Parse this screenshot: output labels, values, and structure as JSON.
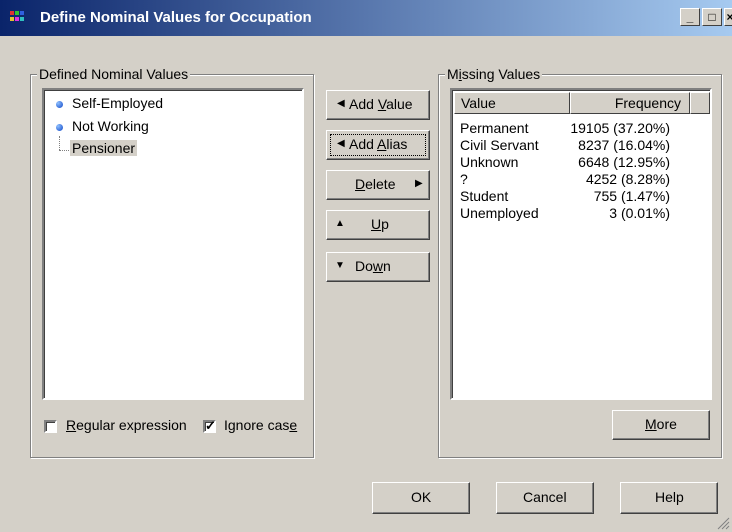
{
  "window": {
    "title": "Define Nominal Values for Occupation"
  },
  "defined": {
    "group_label": "Defined Nominal Values",
    "items": [
      {
        "label": "Self-Employed",
        "bullet": true
      },
      {
        "label": "Not Working",
        "bullet": true
      },
      {
        "label": "Pensioner",
        "bullet": false,
        "selected": true
      }
    ],
    "regex_label": "Regular expression",
    "regex_checked": false,
    "ignore_case_label": "Ignore case",
    "ignore_case_checked": true
  },
  "buttons": {
    "add_value": "Add Value",
    "add_alias": "Add Alias",
    "delete": "Delete",
    "up": "Up",
    "down": "Down",
    "more": "More",
    "ok": "OK",
    "cancel": "Cancel",
    "help": "Help"
  },
  "missing": {
    "group_label": "Missing Values",
    "columns": [
      "Value",
      "Frequency"
    ],
    "rows": [
      {
        "value": "Permanent",
        "frequency": "19105 (37.20%)"
      },
      {
        "value": "Civil Servant",
        "frequency": "8237 (16.04%)"
      },
      {
        "value": "Unknown",
        "frequency": "6648 (12.95%)"
      },
      {
        "value": "?",
        "frequency": "4252 (8.28%)"
      },
      {
        "value": "Student",
        "frequency": "755 (1.47%)"
      },
      {
        "value": "Unemployed",
        "frequency": "3 (0.01%)"
      }
    ]
  }
}
